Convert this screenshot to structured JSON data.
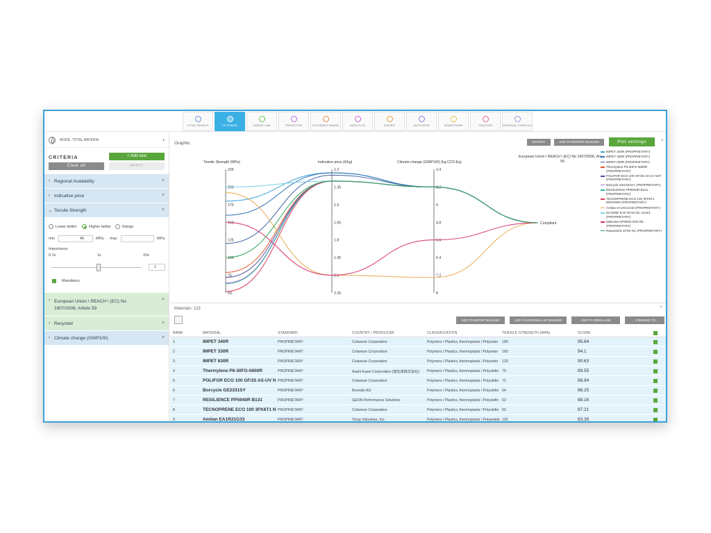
{
  "modules": [
    {
      "label": "TOTAL SEARCH",
      "color": "#6a8fd0",
      "active": false
    },
    {
      "label": "OPTIMIZER",
      "color": "#ffffff",
      "active": true
    },
    {
      "label": "GREEN LINE",
      "color": "#6cbf5a",
      "active": false
    },
    {
      "label": "PREDICTOR",
      "color": "#b56bd6",
      "active": false
    },
    {
      "label": "EXTENDED RANGE",
      "color": "#e8874a",
      "active": false
    },
    {
      "label": "DATA PLUS",
      "color": "#c95fc9",
      "active": false
    },
    {
      "label": "ENVIRO",
      "color": "#e0a030",
      "active": false
    },
    {
      "label": "SUPPLIERS",
      "color": "#8e7ad8",
      "active": false
    },
    {
      "label": "SMARTCOMP",
      "color": "#e8c33a",
      "active": false
    },
    {
      "label": "TRACKER",
      "color": "#e06a8a",
      "active": false
    },
    {
      "label": "MATERIAL CONSOLE",
      "color": "#a88ad8",
      "active": false
    }
  ],
  "left": {
    "mode_label": "MODE: TOTAL MATERIA",
    "criteria_title": "CRITERIA",
    "add_new": "+ Add new",
    "clear_all": "Clear all",
    "apply": "APPLY",
    "criteria": [
      {
        "label": "Regional Availability"
      },
      {
        "label": "Indicative price"
      }
    ],
    "tensile": {
      "label": "Tensile Strength",
      "opt_lower": "Lower better",
      "opt_higher": "Higher better",
      "opt_range": "Range",
      "min_label": "min",
      "min_value": "45",
      "unit1": "MPa",
      "dash": "-",
      "max_label": "max",
      "unit2": "MPa",
      "importance_label": "Importance",
      "scale_min": "0.1x",
      "scale_mid": "1x",
      "scale_max": "10x",
      "importance_value": "1",
      "importance_level": 0.5,
      "mandatory": "Mandatory"
    },
    "criteria_after": [
      {
        "label": "European Union \\ REACH \\ (EC) No 1907/2006, Article 59",
        "green": true
      },
      {
        "label": "Recycled",
        "green": true
      },
      {
        "label": "Climate change (GWP100)",
        "green": false
      }
    ]
  },
  "graphic": {
    "title": "Graphic",
    "export": "EXPORT",
    "add_report": "ADD TO REPORT BUILDER",
    "plot_settings": "Plot settings"
  },
  "chart_data": {
    "type": "parallel-coordinates",
    "axes": [
      {
        "label": "Tensile Strength (MPa)",
        "ticks": [
          "225",
          "200",
          "175",
          "150",
          "125",
          "100",
          "75",
          "50"
        ],
        "range": [
          50,
          225
        ]
      },
      {
        "label": "Indicative price (€/kg)",
        "ticks": [
          "1.2",
          "1.35",
          "1.5",
          "1.65",
          "1.8",
          "1.95",
          "2.1",
          "2.25"
        ],
        "range": [
          1.2,
          2.25
        ]
      },
      {
        "label": "Climate change (GWP100) (kg CO2-Eq)",
        "ticks": [
          "2.4",
          "3.2",
          "4",
          "4.8",
          "5.6",
          "6.4",
          "7.2",
          "8"
        ],
        "range": [
          2.4,
          8
        ]
      },
      {
        "label": "European Union \\ REACH \\ (EC) No 1907/2006, Article 59",
        "ticks": [
          "Compliant"
        ]
      }
    ],
    "series": [
      {
        "name": "IMPET 340R (PROPRIETARY)",
        "color": "#3aa0d8",
        "values": [
          180,
          1.23,
          3.2,
          "Compliant"
        ]
      },
      {
        "name": "IMPET 330R (PROPRIETARY)",
        "color": "#2a6fb0",
        "values": [
          160,
          1.23,
          3.2,
          "Compliant"
        ]
      },
      {
        "name": "IMPET 830R (PROPRIETARY)",
        "color": "#3a5fa0",
        "values": [
          120,
          1.25,
          3.2,
          "Compliant"
        ]
      },
      {
        "name": "Thermylene P6-30FG-0600R (PROPRIETARY)",
        "color": "#e0552a",
        "values": [
          79,
          1.3,
          3.2,
          "Compliant"
        ]
      },
      {
        "name": "POLIFOR ECO 100 GF/25 AS-UV NAT (PROPRIETARY)",
        "color": "#4a4a9a",
        "values": [
          72,
          1.3,
          3.2,
          "Compliant"
        ]
      },
      {
        "name": "Borcycle GE2331SY (PROPRIETARY)",
        "color": "#a86ad0",
        "values": [
          64,
          1.3,
          3.2,
          "Compliant"
        ]
      },
      {
        "name": "RESILIENCE PP5940R B131 (PROPRIETARY)",
        "color": "#2ab0a0",
        "values": [
          63,
          1.3,
          3.2,
          "Compliant"
        ]
      },
      {
        "name": "TECNOPRENE ECO 100 3FK6T1 NERO900 (PROPRIETARY)",
        "color": "#d93a5a",
        "values": [
          52,
          1.3,
          3.2,
          "Compliant"
        ]
      },
      {
        "name": "Amilan EA1R21G33 (PROPRIETARY)",
        "color": "#e8a850",
        "values": [
          192,
          2.1,
          7.3,
          "Compliant"
        ]
      },
      {
        "name": "ECOMID B W GF33 NC 1102/1 (PROPRIETARY)",
        "color": "#7ad0e8",
        "values": [
          200,
          1.3,
          3.2,
          "Compliant"
        ]
      },
      {
        "name": "Makrolon EP9920 R30 RE (PROPRIETARY)",
        "color": "#d8306a",
        "values": [
          150,
          2.1,
          5.6,
          "Compliant"
        ]
      },
      {
        "name": "Ravamid B GF50 NC (PROPRIETARY)",
        "color": "#2aa05a",
        "values": [
          100,
          1.3,
          3.2,
          "Compliant"
        ]
      }
    ]
  },
  "materials": {
    "count_label": "Materials: 123",
    "btn_report": "ADD TO REPORT BUILDER",
    "btn_list": "ADD TO MATERIAL LIST BUILDER",
    "btn_green": "ADD TO GREEN LINE",
    "btn_forward": "← FORWARD TO...",
    "columns": [
      "RANK",
      "MATERIAL",
      "STANDARD",
      "COUNTRY / PRODUCER",
      "CLASSIFICATION",
      "TENSILE STRENGTH (MPA)",
      "SCORE"
    ],
    "rows": [
      [
        "1",
        "IMPET 340R",
        "PROPRIETARY",
        "Celanese Corporation",
        "Polymers / Plastics, thermoplasts / Polyester",
        "180",
        "95.84"
      ],
      [
        "2",
        "IMPET 330R",
        "PROPRIETARY",
        "Celanese Corporation",
        "Polymers / Plastics, thermoplasts / Polyester",
        "160",
        "94.1"
      ],
      [
        "3",
        "IMPET 830R",
        "PROPRIETARY",
        "Celanese Corporation",
        "Polymers / Plastics, thermoplasts / Polyester",
        "120",
        "90.63"
      ],
      [
        "4",
        "Thermylene P6-30FG-0600R",
        "PROPRIETARY",
        "Asahi Kasei Corporation (旭化成株式会社)",
        "Polymers / Plastics, thermoplasts / Polyolefin",
        "79",
        "89.55"
      ],
      [
        "5",
        "POLIFOR ECO 100 GF/25 AS-UV NAT",
        "PROPRIETARY",
        "Celanese Corporation",
        "Polymers / Plastics, thermoplasts / Polyolefin",
        "72",
        "88.94"
      ],
      [
        "6",
        "Borcycle GE2331SY",
        "PROPRIETARY",
        "Borealis AG",
        "Polymers / Plastics, thermoplasts / Polyolefin",
        "64",
        "88.25"
      ],
      [
        "7",
        "RESILIENCE PP5940R B131",
        "PROPRIETARY",
        "GEON Performance Solutions",
        "Polymers / Plastics, thermoplasts / Polyolefin",
        "63",
        "88.16"
      ],
      [
        "8",
        "TECNOPRENE ECO 100 3FK6T1 NERO900",
        "PROPRIETARY",
        "Celanese Corporation",
        "Polymers / Plastics, thermoplasts / Polyolefin",
        "52",
        "87.21"
      ],
      [
        "9",
        "Amilan EA1R21G33",
        "PROPRIETARY",
        "Toray Industries, Inc.",
        "Polymers / Plastics, thermoplasts / Polyamide",
        "192",
        "83.39"
      ]
    ]
  }
}
